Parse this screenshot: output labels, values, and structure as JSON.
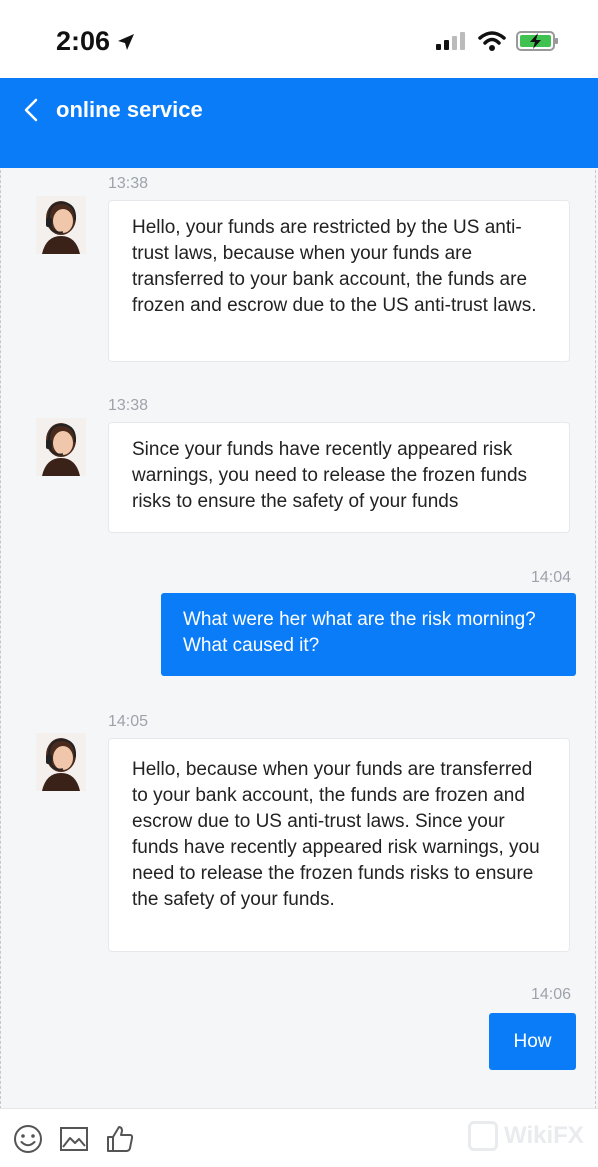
{
  "status_bar": {
    "time": "2:06"
  },
  "header": {
    "title": "online service"
  },
  "messages": [
    {
      "time": "13:38",
      "text": "Hello, your funds are restricted by the US anti-trust laws, because when your funds are transferred to your bank account, the funds are frozen and escrow due to the US anti-trust laws."
    },
    {
      "time": "13:38",
      "text": "Since your funds have recently appeared risk warnings, you need to release the frozen funds risks to ensure the safety of your funds"
    },
    {
      "time": "14:04",
      "text": "What were her what are the risk morning? What caused it?"
    },
    {
      "time": "14:05",
      "text": "Hello, because when your funds are transferred to your bank account, the funds are frozen and escrow due to US anti-trust laws. Since your funds have recently appeared risk warnings, you need to release the frozen funds risks to ensure the safety of your funds."
    },
    {
      "time": "14:06",
      "text": "How"
    }
  ],
  "watermark": "WikiFX",
  "colors": {
    "accent": "#0a7cf8",
    "background": "#f5f6f8",
    "bubble": "#ffffff"
  },
  "toolbar": {
    "icons": [
      "smile-icon",
      "image-icon",
      "thumbs-up-icon"
    ]
  }
}
